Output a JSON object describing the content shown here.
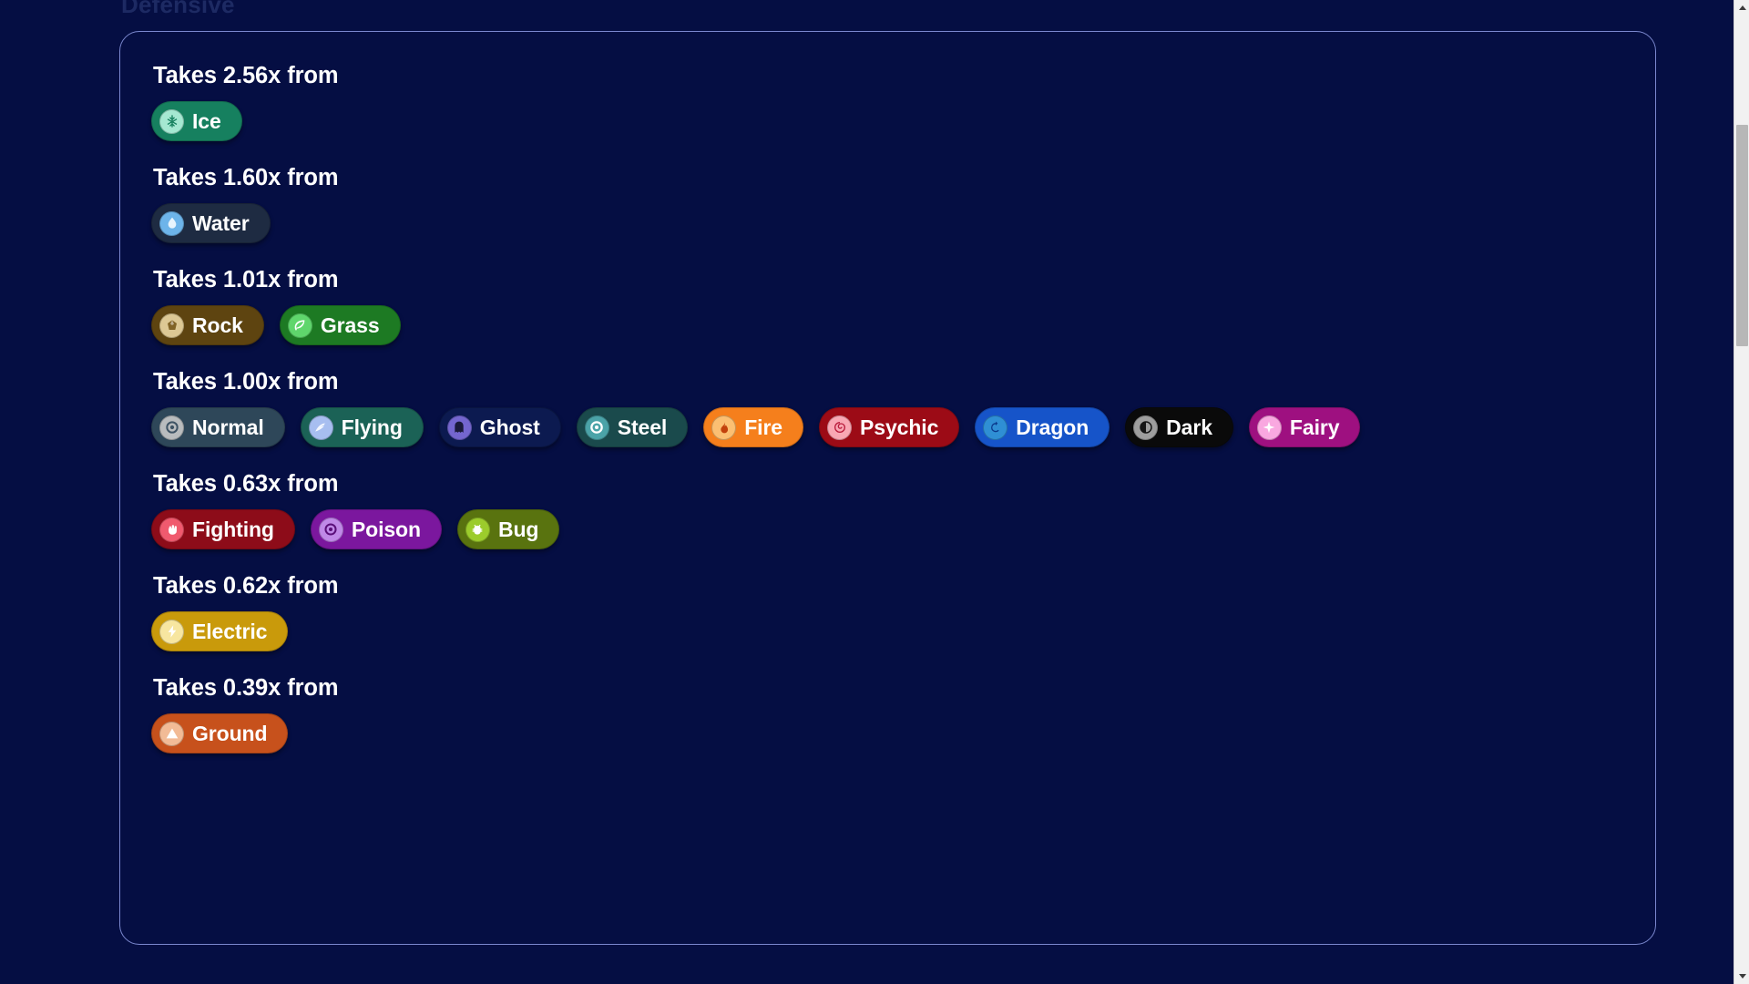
{
  "page": {
    "background_color": "#050e43",
    "card_border_color": "#7b88cf",
    "partial_heading_above_card": "Defensive"
  },
  "scrollbar": {
    "up_arrow": "▲",
    "down_arrow": "▼",
    "position": "right"
  },
  "groups": [
    {
      "title": "Takes 2.56x from",
      "multiplier": "2.56x",
      "types": [
        {
          "label": "Ice",
          "icon": "snowflake-icon",
          "bg": "#16805f",
          "icon_bg": "#a5e8d2",
          "icon_fg": "#16805f"
        }
      ]
    },
    {
      "title": "Takes 1.60x from",
      "multiplier": "1.60x",
      "types": [
        {
          "label": "Water",
          "icon": "water-drop-icon",
          "bg": "#1e2b42",
          "icon_bg": "#6db4ea",
          "icon_fg": "#e8f4fd"
        }
      ]
    },
    {
      "title": "Takes 1.01x from",
      "multiplier": "1.01x",
      "types": [
        {
          "label": "Rock",
          "icon": "rock-icon",
          "bg": "#5e4410",
          "icon_bg": "#ddc894",
          "icon_fg": "#7b5e20"
        },
        {
          "label": "Grass",
          "icon": "leaf-icon",
          "bg": "#1d7a23",
          "icon_bg": "#5fd66c",
          "icon_fg": "#ffffff"
        }
      ]
    },
    {
      "title": "Takes 1.00x from",
      "multiplier": "1.00x",
      "types": [
        {
          "label": "Normal",
          "icon": "ring-icon",
          "bg": "#2e4759",
          "icon_bg": "#b9bcbe",
          "icon_fg": "#3e5364"
        },
        {
          "label": "Flying",
          "icon": "wing-icon",
          "bg": "#1b6256",
          "icon_bg": "#a7bef0",
          "icon_fg": "#f3f7ff"
        },
        {
          "label": "Ghost",
          "icon": "ghost-icon",
          "bg": "#0c1a50",
          "icon_bg": "#7466cf",
          "icon_fg": "#1a1a3a"
        },
        {
          "label": "Steel",
          "icon": "gear-ring-icon",
          "bg": "#1a4a4c",
          "icon_bg": "#4ba3a8",
          "icon_fg": "#ffffff"
        },
        {
          "label": "Fire",
          "icon": "flame-icon",
          "bg": "#f57f1c",
          "icon_bg": "#fbbf72",
          "icon_fg": "#c2410c"
        },
        {
          "label": "Psychic",
          "icon": "swirl-icon",
          "bg": "#9c0b16",
          "icon_bg": "#f9a8b4",
          "icon_fg": "#b91c3c"
        },
        {
          "label": "Dragon",
          "icon": "dragon-spiral-icon",
          "bg": "#1654c9",
          "icon_bg": "#2f8fd4",
          "icon_fg": "#0b3a8c"
        },
        {
          "label": "Dark",
          "icon": "moon-icon",
          "bg": "#0a0a0a",
          "icon_bg": "#9e9e9e",
          "icon_fg": "#151515"
        },
        {
          "label": "Fairy",
          "icon": "sparkle-icon",
          "bg": "#9e1080",
          "icon_bg": "#f9a8e0",
          "icon_fg": "#ffffff"
        }
      ]
    },
    {
      "title": "Takes 0.63x from",
      "multiplier": "0.63x",
      "types": [
        {
          "label": "Fighting",
          "icon": "fist-icon",
          "bg": "#8d0c19",
          "icon_bg": "#f05a6e",
          "icon_fg": "#ffffff"
        },
        {
          "label": "Poison",
          "icon": "poison-icon",
          "bg": "#7b179e",
          "icon_bg": "#c089e8",
          "icon_fg": "#5a0f79"
        },
        {
          "label": "Bug",
          "icon": "bug-icon",
          "bg": "#59730f",
          "icon_bg": "#9ccc2c",
          "icon_fg": "#ffffff"
        }
      ]
    },
    {
      "title": "Takes 0.62x from",
      "multiplier": "0.62x",
      "types": [
        {
          "label": "Electric",
          "icon": "lightning-bolt-icon",
          "bg": "#c99a0b",
          "icon_bg": "#f7e6a0",
          "icon_fg": "#ffffff"
        }
      ]
    },
    {
      "title": "Takes 0.39x from",
      "multiplier": "0.39x",
      "types": [
        {
          "label": "Ground",
          "icon": "mountain-icon",
          "bg": "#c7511c",
          "icon_bg": "#f2bb96",
          "icon_fg": "#ffffff"
        }
      ]
    }
  ]
}
